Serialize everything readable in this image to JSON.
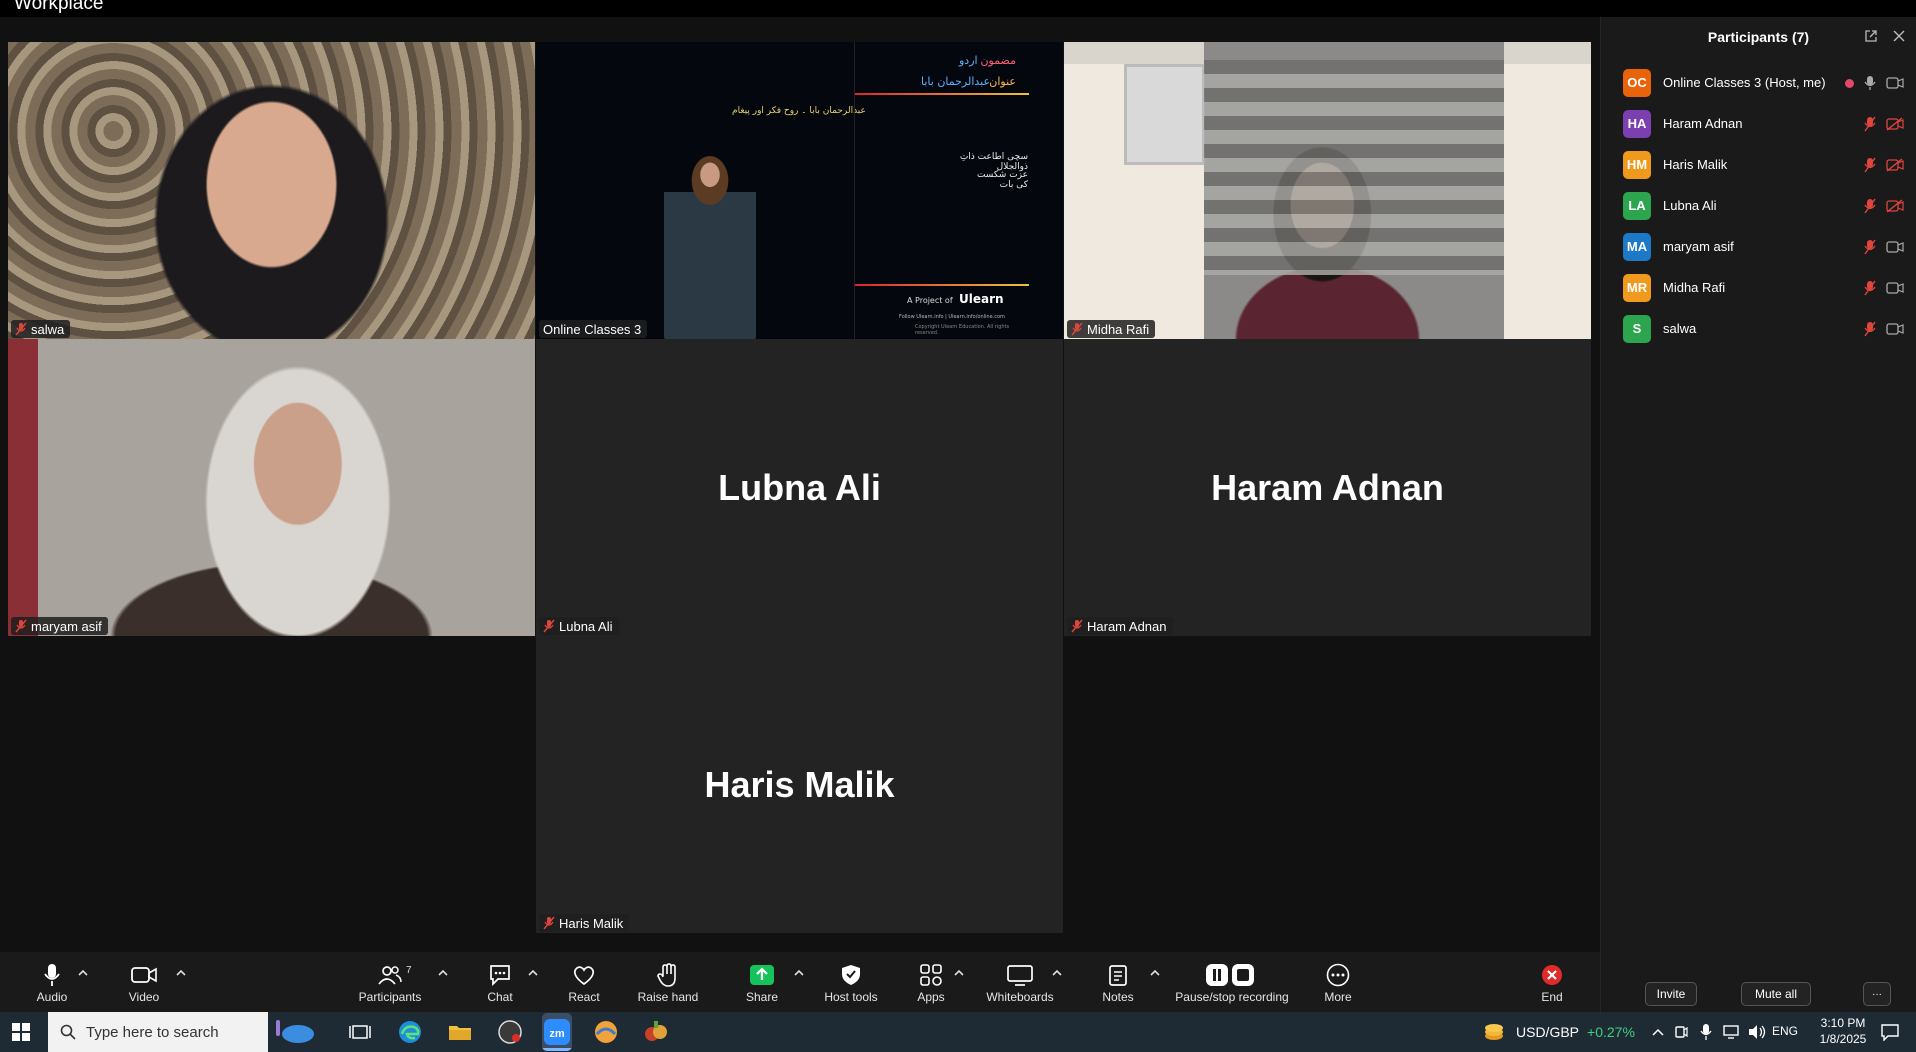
{
  "window": {
    "title": "Workplace"
  },
  "tiles": {
    "salwa": {
      "name": "salwa"
    },
    "host": {
      "name": "Online Classes 3",
      "board": {
        "top_right_1": "مضمون",
        "top_left_1": "اردو",
        "top_right_2": "عنوان",
        "top_left_2": "عبدالرحمان بابا",
        "heading": "عبدالرحمان بابا ۔ روح فکر اور پیغام",
        "note_1": "سچی اطاعت ذاتِ ذوالجلال",
        "note_2": "عزت شکست کی بات",
        "brand_prefix": "A Project of",
        "brand": "Ulearn",
        "footer_1": "Follow Ulearn.info | Ulearn.info/online.com",
        "footer_2": "Copyright Ulearn Education. All rights reserved."
      }
    },
    "midha": {
      "name": "Midha Rafi"
    },
    "maryam": {
      "name": "maryam asif"
    },
    "lubna": {
      "display": "Lubna Ali",
      "name": "Lubna Ali"
    },
    "haram": {
      "display": "Haram Adnan",
      "name": "Haram Adnan"
    },
    "haris": {
      "display": "Haris Malik",
      "name": "Haris Malik"
    }
  },
  "panel": {
    "title": "Participants (7)",
    "participants": [
      {
        "initials": "OC",
        "name": "Online Classes 3 (Host, me)",
        "color": "#e8630a",
        "mic": "on",
        "video": "on",
        "recording": true
      },
      {
        "initials": "HA",
        "name": "Haram Adnan",
        "color": "#7b3fb0",
        "mic": "off",
        "video": "off",
        "recording": false
      },
      {
        "initials": "HM",
        "name": "Haris Malik",
        "color": "#f09a1d",
        "mic": "off",
        "video": "off",
        "recording": false
      },
      {
        "initials": "LA",
        "name": "Lubna Ali",
        "color": "#2da44e",
        "mic": "off",
        "video": "off",
        "recording": false
      },
      {
        "initials": "MA",
        "name": "maryam asif",
        "color": "#1e78c8",
        "mic": "off",
        "video": "on",
        "recording": false
      },
      {
        "initials": "MR",
        "name": "Midha Rafi",
        "color": "#f09a1d",
        "mic": "off",
        "video": "on",
        "recording": false
      },
      {
        "initials": "S",
        "name": "salwa",
        "color": "#2da44e",
        "mic": "off",
        "video": "on",
        "recording": false
      }
    ],
    "invite_label": "Invite",
    "mute_all_label": "Mute all",
    "more_label": "···"
  },
  "toolbar": {
    "audio": "Audio",
    "video": "Video",
    "participants": "Participants",
    "participants_count": "7",
    "chat": "Chat",
    "react": "React",
    "raise_hand": "Raise hand",
    "share": "Share",
    "host_tools": "Host tools",
    "apps": "Apps",
    "whiteboards": "Whiteboards",
    "notes": "Notes",
    "recording": "Pause/stop recording",
    "more": "More",
    "end": "End"
  },
  "taskbar": {
    "search_placeholder": "Type here to search",
    "ticker_label": "USD/GBP",
    "ticker_change": "+0.27%",
    "language": "ENG",
    "time": "3:10 PM",
    "date": "1/8/2025"
  },
  "colors": {
    "active_speaker": "#22d39a",
    "share_green": "#16c35b",
    "end_red": "#e02b2b",
    "muted_red": "#e0453d"
  }
}
